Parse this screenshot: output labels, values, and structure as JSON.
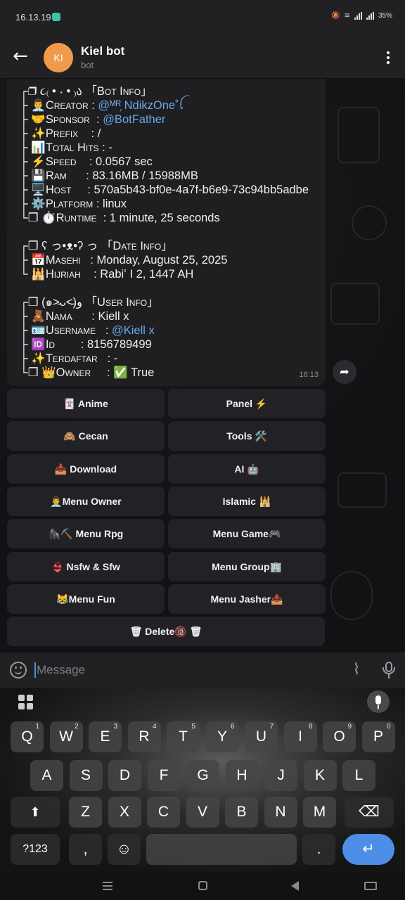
{
  "status_bar": {
    "time": "16.13.19",
    "battery": "35%"
  },
  "header": {
    "avatar_initials": "KI",
    "title": "Kiel bot",
    "subtitle": "bot"
  },
  "message": {
    "lines": [
      {
        "prefix": "┌❒ ૮₍ • ˕ • ₎ა  「",
        "label": "Bot Info",
        "suffix": "」"
      },
      {
        "prefix": "├ 👨‍💼",
        "label": "Creator",
        "sep": " : ",
        "value": "@ᴹᴿ᷊ NdikzOne˚ꪶ",
        "link": true
      },
      {
        "prefix": "├ 🤝",
        "label": "Sponsor",
        "sep": "  : ",
        "value": "@BotFather",
        "link": true
      },
      {
        "prefix": "├ ✨",
        "label": "Prefix",
        "sep": "    : ",
        "value": "/"
      },
      {
        "prefix": "├ 📊",
        "label": "Total Hits",
        "sep": " : ",
        "value": "-"
      },
      {
        "prefix": "├ ⚡",
        "label": "Speed",
        "sep": "    : ",
        "value": "0.0567 sec"
      },
      {
        "prefix": "├ 💾",
        "label": "Ram",
        "sep": "      : ",
        "value": "83.16MB / 15988MB"
      },
      {
        "prefix": "├ 🖥️",
        "label": "Host",
        "sep": "     : ",
        "value": "570a5b43-bf0e-4a7f-b6e9-73c94bb5adbe"
      },
      {
        "prefix": "├ ⚙️",
        "label": "Platform",
        "sep": " : ",
        "value": "linux"
      },
      {
        "prefix": "└❒ ⏱️",
        "label": "Runtime",
        "sep": "  : ",
        "value": "1 minute, 25 seconds"
      },
      {
        "gap": true
      },
      {
        "prefix": "┌❒ ʕ っ•ᴥ•ʔ っ  「",
        "label": "Date Info",
        "suffix": "」"
      },
      {
        "prefix": "├ 📅",
        "label": "Masehi",
        "sep": "   : ",
        "value": "Monday, August 25, 2025"
      },
      {
        "prefix": "└ 🕌",
        "label": "Hijriah",
        "sep": "    : ",
        "value": "Rabiʻ I 2, 1447 AH"
      },
      {
        "gap": true
      },
      {
        "prefix": "┌❒ (๑˃̵ᴗ˂̵)و  「",
        "label": "User Info",
        "suffix": "」"
      },
      {
        "prefix": "├ 🧸",
        "label": "Nama",
        "sep": "      : ",
        "value": "Kiell x"
      },
      {
        "prefix": "├ 🪪",
        "label": "Username",
        "sep": "   : ",
        "value": "@Kiell x",
        "link": true
      },
      {
        "prefix": "├ 🆔",
        "label": "Id",
        "sep": "        : ",
        "value": "8156789499"
      },
      {
        "prefix": "├ ✨",
        "label": "Terdaftar",
        "sep": "   : ",
        "value": "-"
      },
      {
        "prefix": "└❒ 👑",
        "label": "Owner",
        "sep": "     : ",
        "value": "✅ True"
      }
    ],
    "time": "16:13"
  },
  "keyboard_buttons": [
    {
      "label": "🃏 Anime"
    },
    {
      "label": "Panel ⚡"
    },
    {
      "label": "🙈 Cecan"
    },
    {
      "label": "Tools 🛠️"
    },
    {
      "label": "📥 Download"
    },
    {
      "label": "AI 🤖"
    },
    {
      "label": "👨‍💼Menu Owner"
    },
    {
      "label": "Islamic 🕌"
    },
    {
      "label": "🦍⛏️ Menu Rpg"
    },
    {
      "label": "Menu Game🎮"
    },
    {
      "label": "👙 Nsfw & Sfw"
    },
    {
      "label": "Menu Group🏢"
    },
    {
      "label": "😹Menu Fun"
    },
    {
      "label": "Menu Jasher📤"
    }
  ],
  "delete_button": {
    "label": "🗑 Delete🔞 🗑"
  },
  "input": {
    "placeholder": "Message"
  },
  "keyboard": {
    "row1": [
      {
        "k": "Q",
        "s": "1"
      },
      {
        "k": "W",
        "s": "2"
      },
      {
        "k": "E",
        "s": "3"
      },
      {
        "k": "R",
        "s": "4"
      },
      {
        "k": "T",
        "s": "5"
      },
      {
        "k": "Y",
        "s": "6"
      },
      {
        "k": "U",
        "s": "7"
      },
      {
        "k": "I",
        "s": "8"
      },
      {
        "k": "O",
        "s": "9"
      },
      {
        "k": "P",
        "s": "0"
      }
    ],
    "row2": [
      "A",
      "S",
      "D",
      "F",
      "G",
      "H",
      "J",
      "K",
      "L"
    ],
    "row3": [
      "Z",
      "X",
      "C",
      "V",
      "B",
      "N",
      "M"
    ],
    "symbols_key": "?123",
    "comma_key": ",",
    "period_key": "."
  }
}
